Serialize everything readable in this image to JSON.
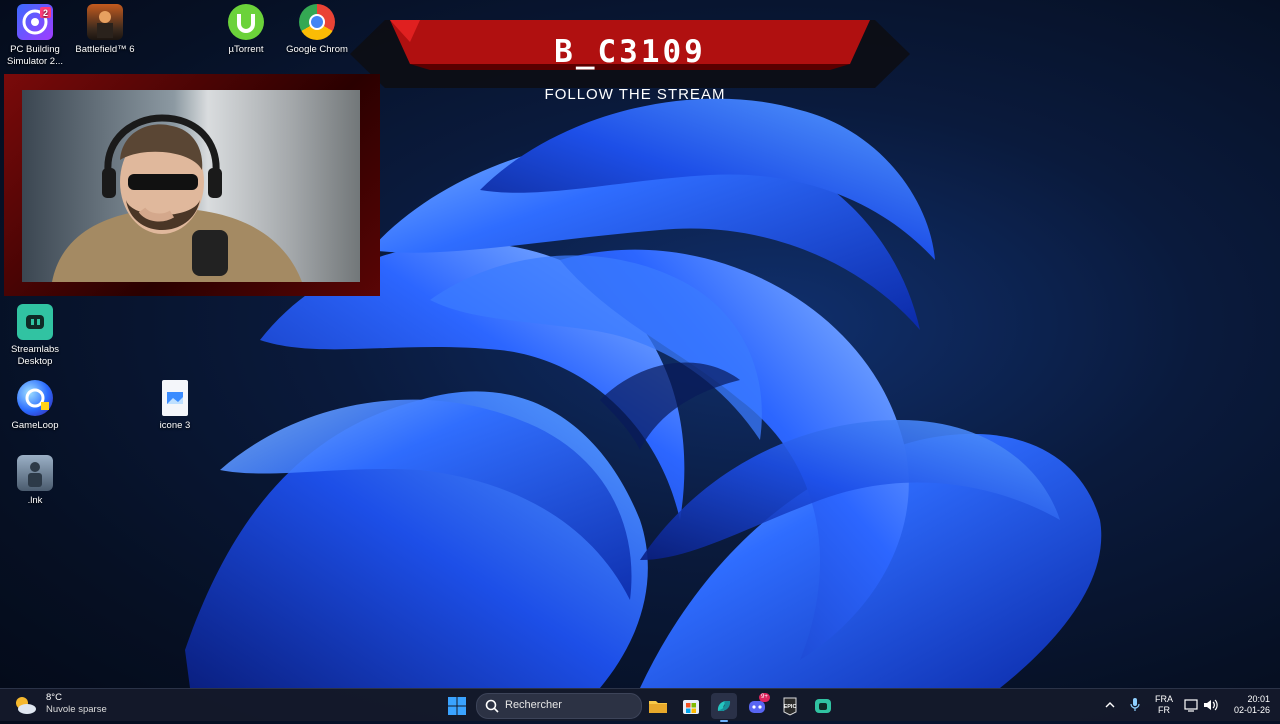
{
  "overlay": {
    "channel_name": "B_C3109",
    "tagline": "FOLLOW THE STREAM"
  },
  "desktop_icons": [
    {
      "label": "PC Building Simulator 2...",
      "icon": "pc-building-simulator-icon"
    },
    {
      "label": "Battlefield™ 6",
      "icon": "battlefield-icon"
    },
    {
      "label": "µTorrent",
      "icon": "utorrent-icon"
    },
    {
      "label": "Google Chrom",
      "icon": "chrome-icon"
    },
    {
      "label": "Streamlabs Desktop",
      "icon": "streamlabs-icon"
    },
    {
      "label": "GameLoop",
      "icon": "gameloop-icon"
    },
    {
      "label": "icone 3",
      "icon": "image-file-icon"
    },
    {
      "label": ".lnk",
      "icon": "game-shortcut-icon"
    }
  ],
  "taskbar": {
    "weather": {
      "temp": "8°C",
      "desc": "Nuvole sparse"
    },
    "search_placeholder": "Rechercher",
    "language": {
      "top": "FRA",
      "bottom": "FR"
    },
    "clock": {
      "time": "20:01",
      "date": "02-01-26"
    },
    "discord_badge": "9+"
  },
  "colors": {
    "accent_red": "#b01010",
    "wallpaper_blue": "#1f5cff",
    "taskbar_bg": "#141a2a"
  }
}
